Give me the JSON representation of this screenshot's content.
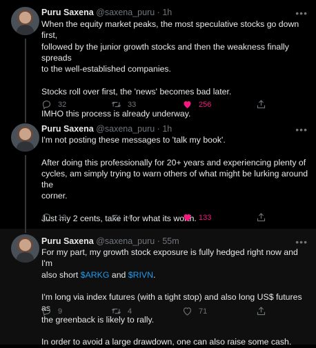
{
  "tweets": [
    {
      "name": "Puru Saxena",
      "handle": "@saxena_puru",
      "dot": "·",
      "time": "1h",
      "lines": [
        "When the equity market peaks, the most speculative stocks go down first,",
        "followed by the junior growth stocks and then the weakness finally spreads",
        "to the well-established companies.",
        "",
        "Stocks roll over first, the 'news' becomes bad later.",
        "",
        "IMHO this process is already underway."
      ],
      "replies": "32",
      "retweets": "33",
      "likes": "256",
      "liked": true
    },
    {
      "name": "Puru Saxena",
      "handle": "@saxena_puru",
      "dot": "·",
      "time": "1h",
      "lines": [
        "I'm not posting these messages to 'talk my book'.",
        "",
        "After doing this professionally for 20+ years and experiencing plenty of",
        "cycles, am simply trying to warn others of what might be lurking around the",
        "corner.",
        "",
        "Just my 2 cents, take it for what its worth."
      ],
      "replies": "13",
      "retweets": "4",
      "likes": "133",
      "liked": true
    },
    {
      "name": "Puru Saxena",
      "handle": "@saxena_puru",
      "dot": "·",
      "time": "55m",
      "line1": "For my part, my growth stock exposure is fully hedged right now and I'm",
      "line2_pre": "also short ",
      "cashtag1": "$ARKG",
      "line2_mid": " and ",
      "cashtag2": "$RIVN",
      "line2_post": ".",
      "lines_after": [
        "",
        "I'm long via index futures (with a tight stop) and also long US$ futures as",
        "the greenback is likely to rally.",
        "",
        "In order to avoid a large drawdown, one can also raise some cash."
      ],
      "replies": "9",
      "retweets": "4",
      "likes": "71",
      "liked": false
    }
  ],
  "colors": {
    "background": "#000000",
    "text": "#e7e9ea",
    "muted": "#71767b",
    "like": "#f91880",
    "link": "#1d9bf0"
  },
  "icons": {
    "reply": "reply-icon",
    "retweet": "retweet-icon",
    "like": "heart-icon",
    "share": "share-icon",
    "more": "more-icon"
  }
}
